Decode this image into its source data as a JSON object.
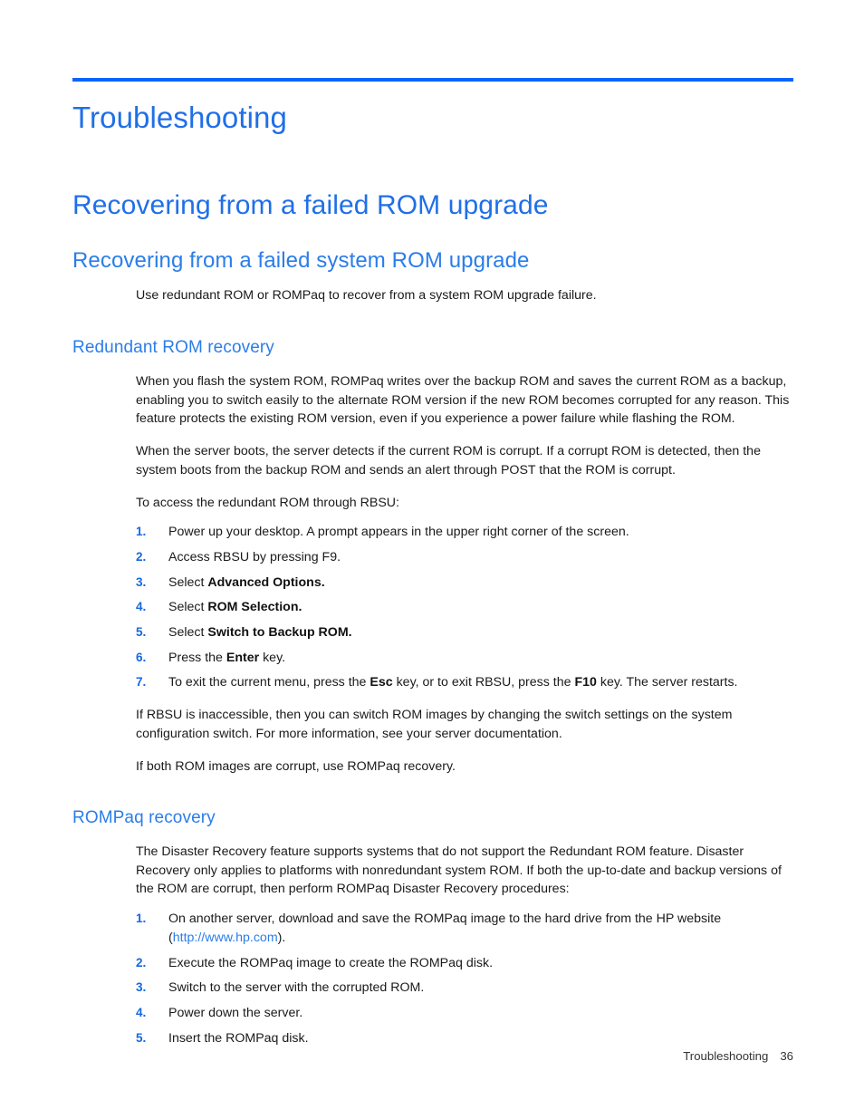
{
  "document": {
    "chapter_title": "Troubleshooting",
    "section_title": "Recovering from a failed ROM upgrade",
    "subsection_title": "Recovering from a failed system ROM upgrade",
    "intro_paragraph": "Use redundant ROM or ROMPaq to recover from a system ROM upgrade failure."
  },
  "redundant_rom": {
    "heading": "Redundant ROM recovery",
    "p1": "When you flash the system ROM, ROMPaq writes over the backup ROM and saves the current ROM as a backup, enabling you to switch easily to the alternate ROM version if the new ROM becomes corrupted for any reason. This feature protects the existing ROM version, even if you experience a power failure while flashing the ROM.",
    "p2": "When the server boots, the server detects if the current ROM is corrupt. If a corrupt ROM is detected, then the system boots from the backup ROM and sends an alert through POST that the ROM is corrupt.",
    "p3": "To access the redundant ROM through RBSU:",
    "steps": [
      {
        "num": "1.",
        "pre": "Power up your desktop. A prompt appears in the upper right corner of the screen.",
        "bold": "",
        "post": ""
      },
      {
        "num": "2.",
        "pre": "Access RBSU by pressing F9.",
        "bold": "",
        "post": ""
      },
      {
        "num": "3.",
        "pre": "Select ",
        "bold": "Advanced Options.",
        "post": ""
      },
      {
        "num": "4.",
        "pre": "Select ",
        "bold": "ROM Selection.",
        "post": ""
      },
      {
        "num": "5.",
        "pre": "Select ",
        "bold": "Switch to Backup ROM.",
        "post": ""
      },
      {
        "num": "6.",
        "pre": "Press the ",
        "bold": "Enter",
        "post": " key."
      },
      {
        "num": "7.",
        "pre": "To exit the current menu, press the ",
        "bold": "Esc",
        "post": " key, or to exit RBSU, press the ",
        "bold2": "F10",
        "post2": " key. The server restarts."
      }
    ],
    "p4": "If RBSU is inaccessible, then you can switch ROM images by changing the switch settings on the system configuration switch. For more information, see your server documentation.",
    "p5": "If both ROM images are corrupt, use ROMPaq recovery."
  },
  "rompaq": {
    "heading": "ROMPaq recovery",
    "p1": "The Disaster Recovery feature supports systems that do not support the Redundant ROM feature. Disaster Recovery only applies to platforms with nonredundant system ROM. If both the up-to-date and backup versions of the ROM are corrupt, then perform ROMPaq Disaster Recovery procedures:",
    "steps": [
      {
        "num": "1.",
        "pre": "On another server, download and save the ROMPaq image to the hard drive from the HP website (",
        "link": "http://www.hp.com",
        "post": ")."
      },
      {
        "num": "2.",
        "pre": "Execute the ROMPaq image to create the ROMPaq disk.",
        "link": "",
        "post": ""
      },
      {
        "num": "3.",
        "pre": "Switch to the server with the corrupted ROM.",
        "link": "",
        "post": ""
      },
      {
        "num": "4.",
        "pre": "Power down the server.",
        "link": "",
        "post": ""
      },
      {
        "num": "5.",
        "pre": "Insert the ROMPaq disk.",
        "link": "",
        "post": ""
      }
    ]
  },
  "footer": {
    "label": "Troubleshooting",
    "page_number": "36"
  },
  "colors": {
    "rule": "#0066ff",
    "heading_blue": "#1f6fe8",
    "subheading_blue": "#2b7de9",
    "list_number_blue": "#1668e3",
    "body_text": "#1a1a1a"
  }
}
